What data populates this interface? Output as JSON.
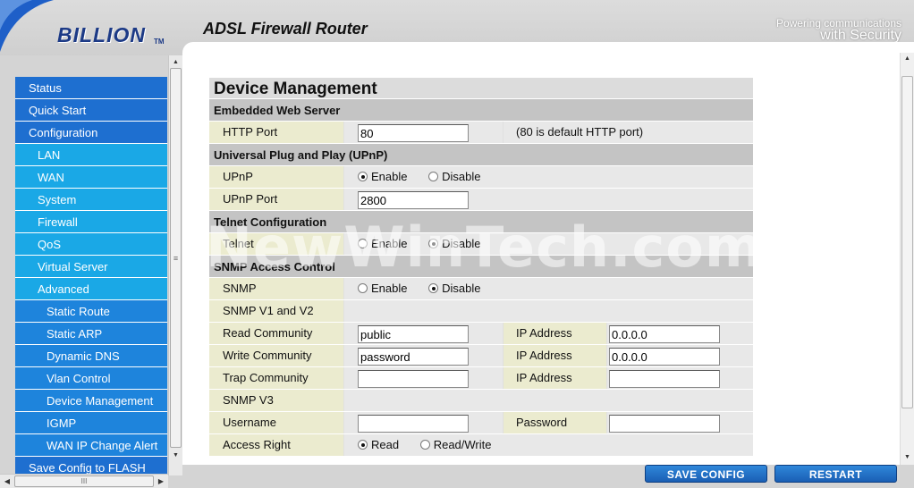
{
  "header": {
    "logo": "BILLION",
    "logo_tm": "TM",
    "title": "ADSL Firewall Router",
    "tagline_line1": "Powering communications",
    "tagline_line2": "with Security"
  },
  "sidebar": {
    "items": [
      {
        "label": "Status",
        "level": 1
      },
      {
        "label": "Quick Start",
        "level": 1
      },
      {
        "label": "Configuration",
        "level": 1
      },
      {
        "label": "LAN",
        "level": 2
      },
      {
        "label": "WAN",
        "level": 2
      },
      {
        "label": "System",
        "level": 2
      },
      {
        "label": "Firewall",
        "level": 2
      },
      {
        "label": "QoS",
        "level": 2
      },
      {
        "label": "Virtual Server",
        "level": 2
      },
      {
        "label": "Advanced",
        "level": 2
      },
      {
        "label": "Static Route",
        "level": 3
      },
      {
        "label": "Static ARP",
        "level": 3
      },
      {
        "label": "Dynamic DNS",
        "level": 3
      },
      {
        "label": "Vlan Control",
        "level": 3
      },
      {
        "label": "Device Management",
        "level": 3
      },
      {
        "label": "IGMP",
        "level": 3
      },
      {
        "label": "WAN IP Change Alert",
        "level": 3
      },
      {
        "label": "Save Config to FLASH",
        "level": 1
      }
    ]
  },
  "main": {
    "page_title": "Device Management",
    "web_server": {
      "section": "Embedded Web Server",
      "http_port_label": "HTTP Port",
      "http_port_value": "80",
      "http_port_note": "(80 is default HTTP port)"
    },
    "upnp": {
      "section": "Universal Plug and Play (UPnP)",
      "upnp_label": "UPnP",
      "enable_label": "Enable",
      "disable_label": "Disable",
      "selected": "Enable",
      "port_label": "UPnP Port",
      "port_value": "2800"
    },
    "telnet": {
      "section": "Telnet Configuration",
      "label": "Telnet",
      "enable_label": "Enable",
      "disable_label": "Disable",
      "selected": "Disable"
    },
    "snmp": {
      "section": "SNMP Access Control",
      "label": "SNMP",
      "enable_label": "Enable",
      "disable_label": "Disable",
      "selected": "Disable",
      "v1v2_label": "SNMP V1 and V2",
      "read_community_label": "Read Community",
      "read_community_value": "public",
      "write_community_label": "Write Community",
      "write_community_value": "password",
      "trap_community_label": "Trap Community",
      "trap_community_value": "",
      "ip_address_label": "IP Address",
      "read_ip_value": "0.0.0.0",
      "write_ip_value": "0.0.0.0",
      "trap_ip_value": "",
      "v3_label": "SNMP V3",
      "username_label": "Username",
      "username_value": "",
      "password_label": "Password",
      "password_value": "",
      "access_right_label": "Access Right",
      "read_label": "Read",
      "readwrite_label": "Read/Write",
      "access_selected": "Read"
    }
  },
  "footer": {
    "save_config": "SAVE CONFIG",
    "restart": "RESTART"
  },
  "watermark": "NewWinTech.com",
  "colors": {
    "nav_level1": "#1e6fd0",
    "nav_level2": "#1aa8e6",
    "nav_level3": "#1e84dc",
    "label_cell": "#ebebcf",
    "section_header": "#c4c4c4"
  }
}
